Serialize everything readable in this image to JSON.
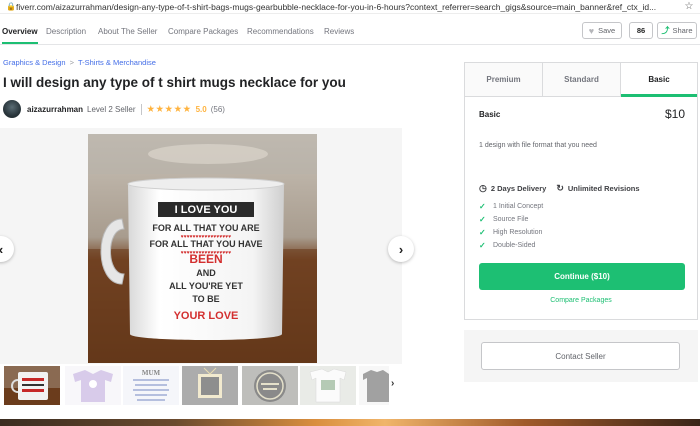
{
  "browser": {
    "url": "fiverr.com/aizazurrahman/design-any-type-of-t-shirt-bags-mugs-gearbubble-necklace-for-you-in-6-hours?context_referrer=search_gigs&source=main_banner&ref_ctx_id...",
    "lock_icon": "lock-icon",
    "bookmark_icon": "star-icon"
  },
  "nav": {
    "tabs": [
      {
        "label": "Overview"
      },
      {
        "label": "Description"
      },
      {
        "label": "About The Seller"
      },
      {
        "label": "Compare Packages"
      },
      {
        "label": "Recommendations"
      },
      {
        "label": "Reviews"
      }
    ],
    "active_tab": "Overview",
    "save_label": "Save",
    "save_count": "86",
    "share_label": "Share"
  },
  "breadcrumb": {
    "category": "Graphics & Design",
    "separator": ">",
    "subcategory": "T-Shirts & Merchandise"
  },
  "gig": {
    "title": "I will design any type of t shirt mugs necklace for you"
  },
  "seller": {
    "name": "aizazurrahman",
    "level": "Level 2 Seller",
    "stars": "★★★★★",
    "rating": "5.0",
    "reviews": "(56)"
  },
  "gallery": {
    "mug_text": [
      "I LOVE YOU",
      "FOR ALL THAT YOU ARE",
      "FOR ALL THAT YOU HAVE",
      "BEEN",
      "AND",
      "ALL YOU'RE YET",
      "TO BE",
      "YOUR LOVE"
    ],
    "prev_label": "‹",
    "next_label": "›",
    "thumbs_next_label": "›",
    "thumb2_text": "MUM"
  },
  "packages": {
    "tabs": [
      "Premium",
      "Standard",
      "Basic"
    ],
    "active": "Basic",
    "name": "Basic",
    "price": "$10",
    "description": "1 design with file format that you need",
    "delivery": "2 Days Delivery",
    "revisions": "Unlimited Revisions",
    "features": [
      "1 Initial Concept",
      "Source File",
      "High Resolution",
      "Double-Sided"
    ],
    "continue_label": "Continue ($10)",
    "compare_label": "Compare Packages"
  },
  "contact": {
    "label": "Contact Seller"
  },
  "colors": {
    "accent": "#1dbf73",
    "link": "#446ee7",
    "star": "#ffb33e"
  }
}
